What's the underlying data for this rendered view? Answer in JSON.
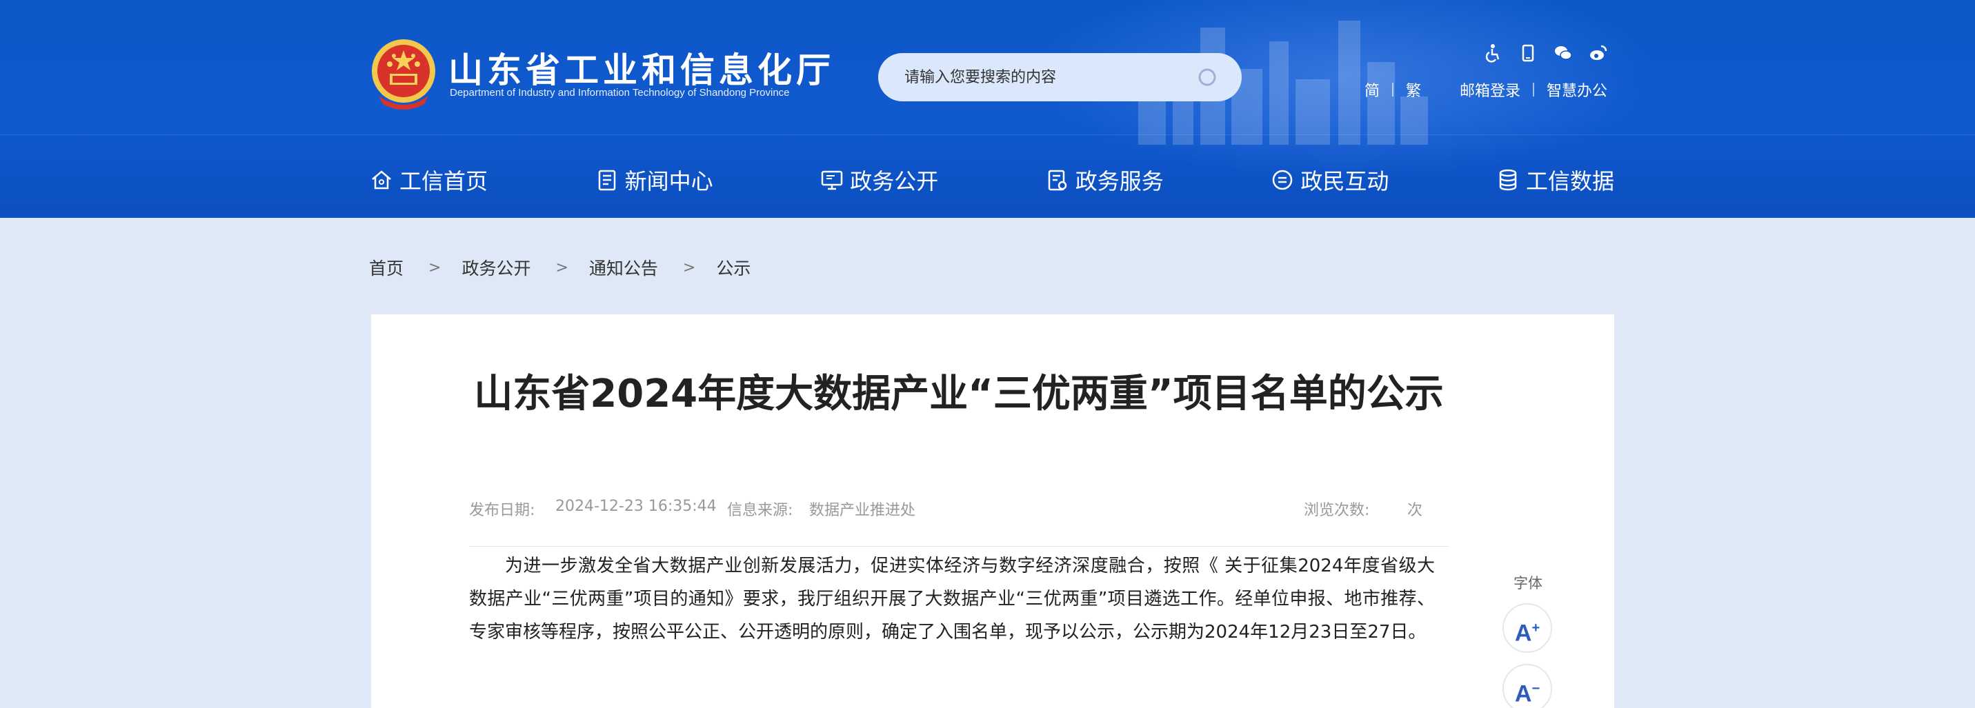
{
  "header": {
    "site_title": "山东省工业和信息化厅",
    "site_subtitle": "Department of Industry and Information Technology of Shandong Province",
    "search_placeholder": "请输入您要搜索的内容",
    "top_links": {
      "simplified": "简",
      "traditional": "繁",
      "mail_login": "邮箱登录",
      "smart_office": "智慧办公"
    },
    "top_icons": [
      "accessibility-icon",
      "mobile-icon",
      "wechat-icon",
      "weibo-icon"
    ]
  },
  "nav": [
    {
      "label": "工信首页",
      "icon": "home-icon"
    },
    {
      "label": "新闻中心",
      "icon": "news-icon"
    },
    {
      "label": "政务公开",
      "icon": "monitor-icon"
    },
    {
      "label": "政务服务",
      "icon": "service-icon"
    },
    {
      "label": "政民互动",
      "icon": "chat-icon"
    },
    {
      "label": "工信数据",
      "icon": "database-icon"
    }
  ],
  "breadcrumb": [
    "首页",
    "政务公开",
    "通知公告",
    "公示"
  ],
  "breadcrumb_separator": ">",
  "article": {
    "title": "山东省2024年度大数据产业“三优两重”项目名单的公示",
    "publish_label": "发布日期:",
    "publish_date": "2024-12-23 16:35:44",
    "source_label": "信息来源:",
    "source": "数据产业推进处",
    "views_label": "浏览次数:",
    "views_unit": "次",
    "paragraph": "为进一步激发全省大数据产业创新发展活力，促进实体经济与数字经济深度融合，按照《 关于征集2024年度省级大数据产业“三优两重”项目的通知》要求，我厅组织开展了大数据产业“三优两重”项目遴选工作。经单位申报、地市推荐、专家审核等程序，按照公平公正、公开透明的原则，确定了入围名单，现予以公示，公示期为2024年12月23日至27日。"
  },
  "font_tool": {
    "label": "字体",
    "increase": "A",
    "increase_sup": "+",
    "decrease": "A",
    "decrease_sup": "−"
  },
  "colors": {
    "header_blue": "#0d58c8",
    "page_bg": "#dfe8f6",
    "accent": "#2d5db9"
  }
}
